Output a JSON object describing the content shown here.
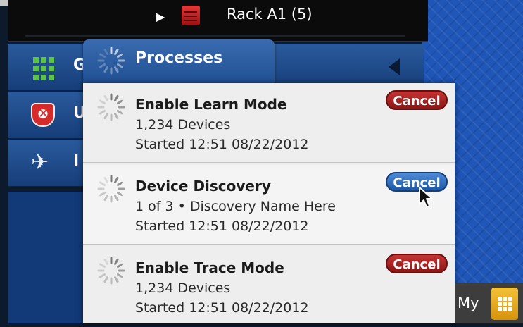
{
  "rack_row": {
    "label": "Rack A1 (5)"
  },
  "sidebar": {
    "items": [
      {
        "label": "G",
        "icon": "grid-icon"
      },
      {
        "label": "U",
        "icon": "shield-icon"
      },
      {
        "label": "I",
        "icon": "plane-icon"
      }
    ]
  },
  "processes_tab": {
    "label": "Processes"
  },
  "processes": [
    {
      "title": "Enable Learn Mode",
      "detail": "1,234 Devices",
      "started": "Started 12:51 08/22/2012",
      "cancel_label": "Cancel",
      "hover": false
    },
    {
      "title": "Device Discovery",
      "detail": "1 of 3 • Discovery Name Here",
      "started": "Started 12:51 08/22/2012",
      "cancel_label": "Cancel",
      "hover": true
    },
    {
      "title": "Enable Trace Mode",
      "detail": "1,234 Devices",
      "started": "Started 12:51 08/22/2012",
      "cancel_label": "Cancel",
      "hover": false
    }
  ],
  "bottom_bar": {
    "label": "My"
  },
  "colors": {
    "cancel_red": "#b01e1e",
    "cancel_blue": "#2f6ec1",
    "accent_blue": "#1f56b8"
  }
}
